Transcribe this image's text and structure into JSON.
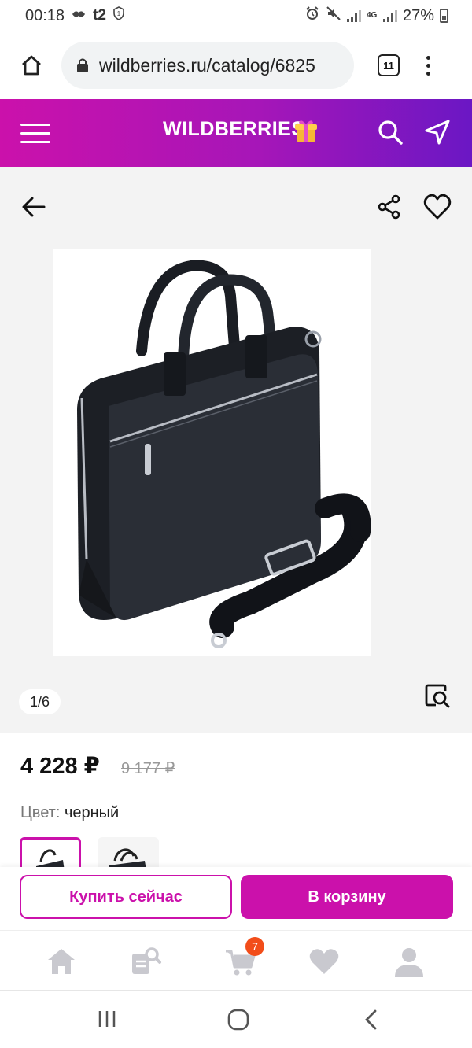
{
  "status_bar": {
    "time": "00:18",
    "carrier": "t2",
    "network": "4G",
    "battery": "27%"
  },
  "browser": {
    "url": "wildberries.ru/catalog/6825",
    "tab_count": "11"
  },
  "header": {
    "logo_text": "WILDBERRIES",
    "brand_color": "#cb11ab"
  },
  "gallery": {
    "counter": "1/6"
  },
  "product": {
    "price": "4 228 ₽",
    "old_price": "9 177 ₽",
    "color_label": "Цвет:",
    "color_value": "черный"
  },
  "actions": {
    "buy_now": "Купить сейчас",
    "add_to_cart": "В корзину"
  },
  "bottom_nav": {
    "cart_badge": "7",
    "items": [
      "home-icon",
      "catalog-search-icon",
      "cart-icon",
      "heart-icon",
      "profile-icon"
    ]
  }
}
